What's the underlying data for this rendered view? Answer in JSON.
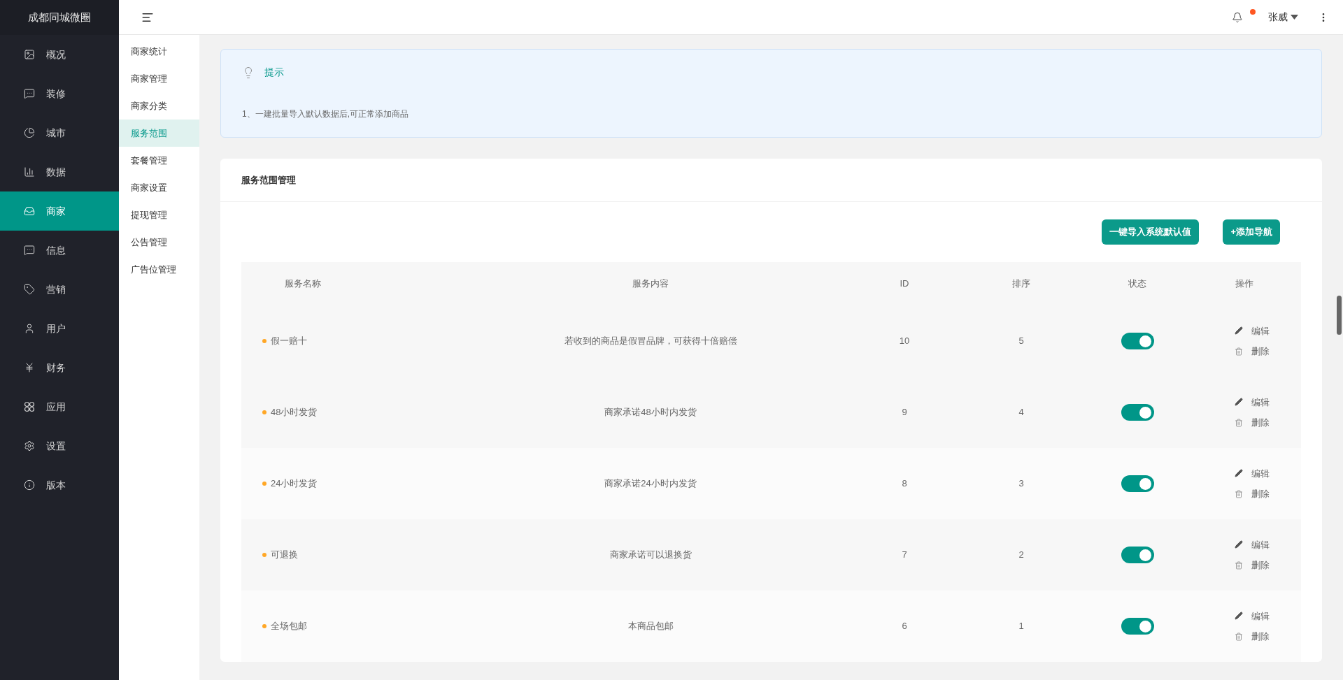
{
  "brand": "成都同城微圈",
  "top_bar": {
    "has_notification": true,
    "user": "张威"
  },
  "nav": [
    {
      "kind": "overview",
      "label": "概况",
      "selected": false
    },
    {
      "kind": "chat",
      "label": "装修",
      "selected": false
    },
    {
      "kind": "gauge",
      "label": "城市",
      "selected": false
    },
    {
      "kind": "bars",
      "label": "数据",
      "selected": false
    },
    {
      "kind": "store",
      "label": "商家",
      "selected": true
    },
    {
      "kind": "chat",
      "label": "信息",
      "selected": false
    },
    {
      "kind": "tag",
      "label": "营销",
      "selected": false
    },
    {
      "kind": "user",
      "label": "用户",
      "selected": false
    },
    {
      "kind": "yen",
      "label": "财务",
      "selected": false
    },
    {
      "kind": "apps",
      "label": "应用",
      "selected": false
    },
    {
      "kind": "settings",
      "label": "设置",
      "selected": false
    },
    {
      "kind": "info",
      "label": "版本",
      "selected": false
    }
  ],
  "submenu": [
    {
      "label": "商家统计",
      "selected": false
    },
    {
      "label": "商家管理",
      "selected": false
    },
    {
      "label": "商家分类",
      "selected": false
    },
    {
      "label": "服务范围",
      "selected": true
    },
    {
      "label": "套餐管理",
      "selected": false
    },
    {
      "label": "商家设置",
      "selected": false
    },
    {
      "label": "提现管理",
      "selected": false
    },
    {
      "label": "公告管理",
      "selected": false
    },
    {
      "label": "广告位管理",
      "selected": false
    }
  ],
  "tip": {
    "title": "提示",
    "lines": [
      "1、一建批量导入默认数据后,可正常添加商品"
    ]
  },
  "card": {
    "title": "服务范围管理",
    "buttons": [
      "一键导入系统默认值",
      "+添加导航"
    ],
    "table": {
      "columns": [
        "服务名称",
        "服务内容",
        "ID",
        "排序",
        "状态",
        "操作"
      ],
      "rows": [
        {
          "name": "假一赔十",
          "content": "若收到的商品是假冒品牌，可获得十倍赔偿",
          "id": "10",
          "sort": "5",
          "on": true,
          "actions": [
            {
              "kind": "edit",
              "label": "编辑"
            },
            {
              "kind": "delete",
              "label": "删除"
            }
          ]
        },
        {
          "name": "48小时发货",
          "content": "商家承诺48小时内发货",
          "id": "9",
          "sort": "4",
          "on": true,
          "actions": [
            {
              "kind": "edit",
              "label": "编辑"
            },
            {
              "kind": "delete",
              "label": "删除"
            }
          ]
        },
        {
          "name": "24小时发货",
          "content": "商家承诺24小时内发货",
          "id": "8",
          "sort": "3",
          "on": true,
          "actions": [
            {
              "kind": "edit",
              "label": "编辑"
            },
            {
              "kind": "delete",
              "label": "删除"
            }
          ]
        },
        {
          "name": "可退换",
          "content": "商家承诺可以退换货",
          "id": "7",
          "sort": "2",
          "on": true,
          "actions": [
            {
              "kind": "edit",
              "label": "编辑"
            },
            {
              "kind": "delete",
              "label": "删除"
            }
          ]
        },
        {
          "name": "全场包邮",
          "content": "本商品包邮",
          "id": "6",
          "sort": "1",
          "on": true,
          "actions": [
            {
              "kind": "edit",
              "label": "编辑"
            },
            {
              "kind": "delete",
              "label": "删除"
            }
          ]
        }
      ]
    }
  }
}
